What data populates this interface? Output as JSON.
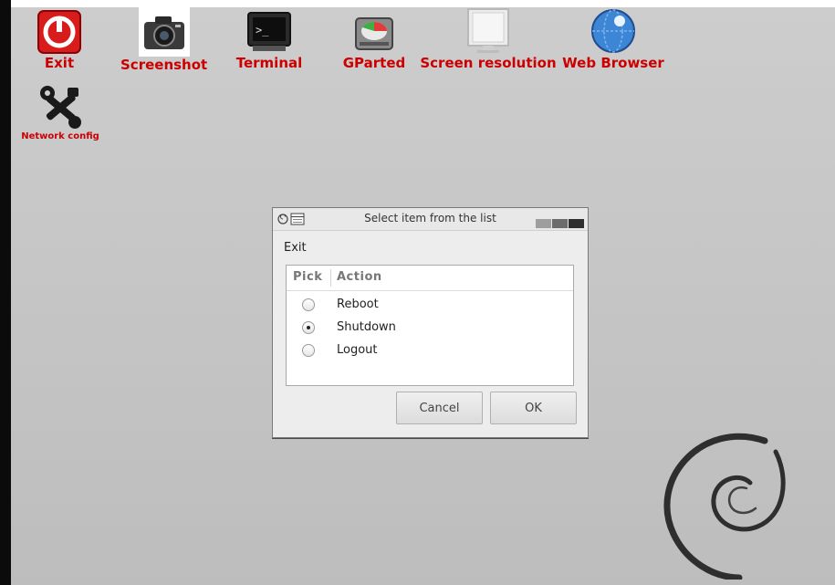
{
  "desktop": {
    "icons": [
      {
        "label": "Exit",
        "icon": "power-icon"
      },
      {
        "label": "Screenshot",
        "icon": "camera-icon"
      },
      {
        "label": "Terminal",
        "icon": "terminal-icon"
      },
      {
        "label": "GParted",
        "icon": "disk-icon"
      },
      {
        "label": "Screen resolution",
        "icon": "monitor-icon"
      },
      {
        "label": "Web Browser",
        "icon": "globe-icon"
      },
      {
        "label": "Network config",
        "icon": "tools-icon"
      }
    ]
  },
  "dialog": {
    "title": "Select item from the list",
    "prompt": "Exit",
    "columns": [
      "Pick",
      "Action"
    ],
    "rows": [
      {
        "action": "Reboot",
        "selected": false
      },
      {
        "action": "Shutdown",
        "selected": true
      },
      {
        "action": "Logout",
        "selected": false
      }
    ],
    "cancel_label": "Cancel",
    "ok_label": "OK"
  },
  "colors": {
    "icon_label": "#cc0000",
    "desktop_bg": "#c6c6c6",
    "left_bar": "#0b0b0b"
  }
}
